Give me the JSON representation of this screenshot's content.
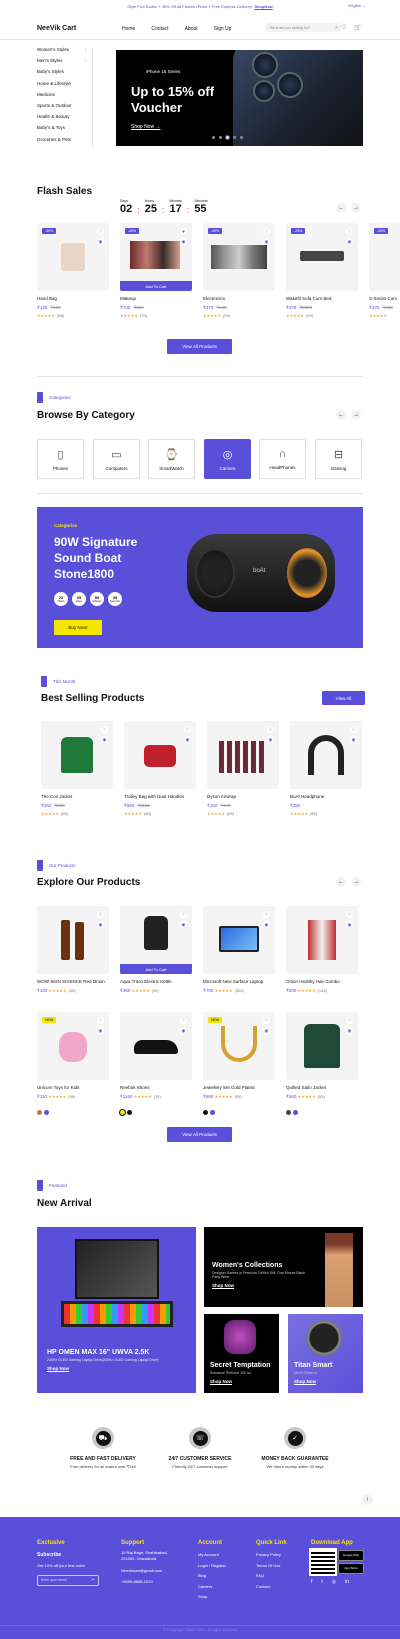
{
  "topbar": {
    "announce": "Style Prot Sades + 45% Off All Fashion Picks + Free Express Delivery!",
    "shop": "ShopNow",
    "lang": "English"
  },
  "header": {
    "logo": "NeeVik Cart",
    "nav": [
      "Home",
      "Contact",
      "About",
      "Sign Up"
    ],
    "search_placeholder": "What are you looking for?"
  },
  "sidebar": {
    "items": [
      {
        "label": "Women's Styles",
        "arrow": true
      },
      {
        "label": "Men's Styles",
        "arrow": true
      },
      {
        "label": "Baby's Styles",
        "arrow": false
      },
      {
        "label": "Home & Lifestyle",
        "arrow": false
      },
      {
        "label": "Medicine",
        "arrow": false
      },
      {
        "label": "Sports & Outdoor",
        "arrow": false
      },
      {
        "label": "Health & Beauty",
        "arrow": false
      },
      {
        "label": "Baby's & Toys",
        "arrow": false
      },
      {
        "label": "Groceries & Pets",
        "arrow": false
      }
    ]
  },
  "hero": {
    "series": "iPhone 15 Series",
    "headline": "Up to 15% off Voucher",
    "cta": "Shop Now"
  },
  "flash": {
    "title": "Flash Sales",
    "timer": [
      {
        "label": "Days",
        "value": "02"
      },
      {
        "label": "Hours",
        "value": "25"
      },
      {
        "label": "Minutes",
        "value": "17"
      },
      {
        "label": "Seconds",
        "value": "55"
      }
    ],
    "products": [
      {
        "name": "Hand Bag",
        "price": "₹120",
        "old": "₹160",
        "reviews": "(88)",
        "disc": "-40%"
      },
      {
        "name": "Makeup",
        "price": "₹700",
        "old": "₹800",
        "reviews": "(75)",
        "disc": "-40%",
        "cart": "Add To Cart"
      },
      {
        "name": "Electronics",
        "price": "₹370",
        "old": "₹400",
        "reviews": "(99)",
        "disc": "-30%"
      },
      {
        "name": "Wakefit Sofa Cum Bed",
        "price": "₹375",
        "old": "₹2850",
        "reviews": "(99)",
        "disc": "-25%"
      },
      {
        "name": "S-Series Com",
        "price": "₹375",
        "old": "₹400",
        "reviews": "",
        "disc": "-25%"
      }
    ],
    "view_all": "View All Products"
  },
  "categories": {
    "tag": "Categories",
    "title": "Browse By Category",
    "items": [
      {
        "label": "Phones",
        "icon": "phone-icon"
      },
      {
        "label": "Computers",
        "icon": "computer-icon"
      },
      {
        "label": "SmartWatch",
        "icon": "watch-icon"
      },
      {
        "label": "Camera",
        "icon": "camera-icon"
      },
      {
        "label": "HeadPhones",
        "icon": "headphones-icon"
      },
      {
        "label": "Gaming",
        "icon": "gamepad-icon"
      }
    ]
  },
  "promo": {
    "tag": "Categories",
    "title": "90W Signature Sound Boat Stone1800",
    "timer": [
      {
        "v": "23",
        "l": "Hours"
      },
      {
        "v": "05",
        "l": "Days"
      },
      {
        "v": "59",
        "l": "Minutes"
      },
      {
        "v": "35",
        "l": "Seconds"
      }
    ],
    "cta": "Buy Now!",
    "brand": "boAt"
  },
  "best": {
    "tag": "This Month",
    "title": "Best Selling Products",
    "view_all": "View All",
    "products": [
      {
        "name": "The Cox Jacket",
        "price": "₹260",
        "old": "₹360",
        "reviews": "(65)"
      },
      {
        "name": "Trolley Bag with Dual Handles",
        "price": "₹960",
        "old": "₹1160",
        "reviews": "(65)"
      },
      {
        "name": "Dyson Airwrap",
        "price": "₹150",
        "old": "₹170",
        "reviews": "(65)"
      },
      {
        "name": "BoAt Headphone",
        "price": "₹350",
        "old": "",
        "reviews": "(65)"
      }
    ]
  },
  "explore": {
    "tag": "Our Products",
    "title": "Explore Our Products",
    "view_all": "View All Products",
    "products": [
      {
        "name": "WOW SKIN SCIENCE Red Onion",
        "price": "₹100",
        "reviews": "(35)"
      },
      {
        "name": "Aqua Triton Electric Kettle",
        "price": "₹360",
        "reviews": "(95)",
        "cart": "Add To Cart"
      },
      {
        "name": "Microsoft New Surface Laptop",
        "price": "₹700",
        "reviews": "(325)"
      },
      {
        "name": "Onion Healthy Hair Combo",
        "price": "₹500",
        "reviews": "(145)"
      },
      {
        "name": "Unicorn Toys for Kids",
        "price": "₹110",
        "reviews": "(65)",
        "new": "NEW"
      },
      {
        "name": "Reebok Shoes",
        "price": "₹1160",
        "reviews": "(35)"
      },
      {
        "name": "Jewellery Set Gold Plated",
        "price": "₹660",
        "reviews": "(55)",
        "new": "NEW"
      },
      {
        "name": "Quilted Satin Jacket",
        "price": "₹660",
        "reviews": "(55)"
      }
    ]
  },
  "arrival": {
    "tag": "Featured",
    "title": "New Arrival",
    "main": {
      "title": "HP OMEN MAX 16\" UWVA 2.5K",
      "desc": "240Hz OLED Gaming Laptop Drive(240Hz OLED Gaming Laptop Drive)",
      "cta": "Shop Now"
    },
    "women": {
      "title": "Women's Collections",
      "desc": "Designer Sarees in Premium Chiffon Silk, One Minute Black Party Wear",
      "cta": "Shop Now"
    },
    "perfume": {
      "title": "Secret Temptation",
      "desc": "Romance Perfume 100 ml",
      "cta": "Shop Now"
    },
    "watch": {
      "title": "Titan Smart",
      "desc": "Men's Rosecol",
      "cta": "Shop Now"
    }
  },
  "services": [
    {
      "title": "FREE AND FAST DELIVERY",
      "desc": "Free delivery for all orders over ₹140"
    },
    {
      "title": "24/7 CUSTOMER SERVICE",
      "desc": "Friendly 24/7 customer support"
    },
    {
      "title": "MONEY BACK GUARANTEE",
      "desc": "We return money within 30 days"
    }
  ],
  "footer": {
    "brand": "Exclusive",
    "subscribe": "Subscribe",
    "offer": "Get 10% off your first order",
    "email_placeholder": "Enter your email",
    "support": {
      "title": "Support",
      "address": "19 Raj Bagh, Shahibabad, 201005, Ghaziabad.",
      "email": "Neevikkart@gmail.com",
      "phone": "+8999-8888-1010"
    },
    "account": {
      "title": "Account",
      "links": [
        "My Account",
        "Login / Register",
        "Blog",
        "Careers",
        "Shop"
      ]
    },
    "quick": {
      "title": "Quick Link",
      "links": [
        "Privacy Policy",
        "Terms Of Use",
        "FAQ",
        "Contact"
      ]
    },
    "download": {
      "title": "Download App",
      "google": "Google Play",
      "apple": "App Store"
    },
    "copyright": "© Copyright Rimel 2022. All right reserved"
  },
  "colors": {
    "accent": "#5a4fd9",
    "star": "#f5a623",
    "yellow": "#f5e600"
  }
}
